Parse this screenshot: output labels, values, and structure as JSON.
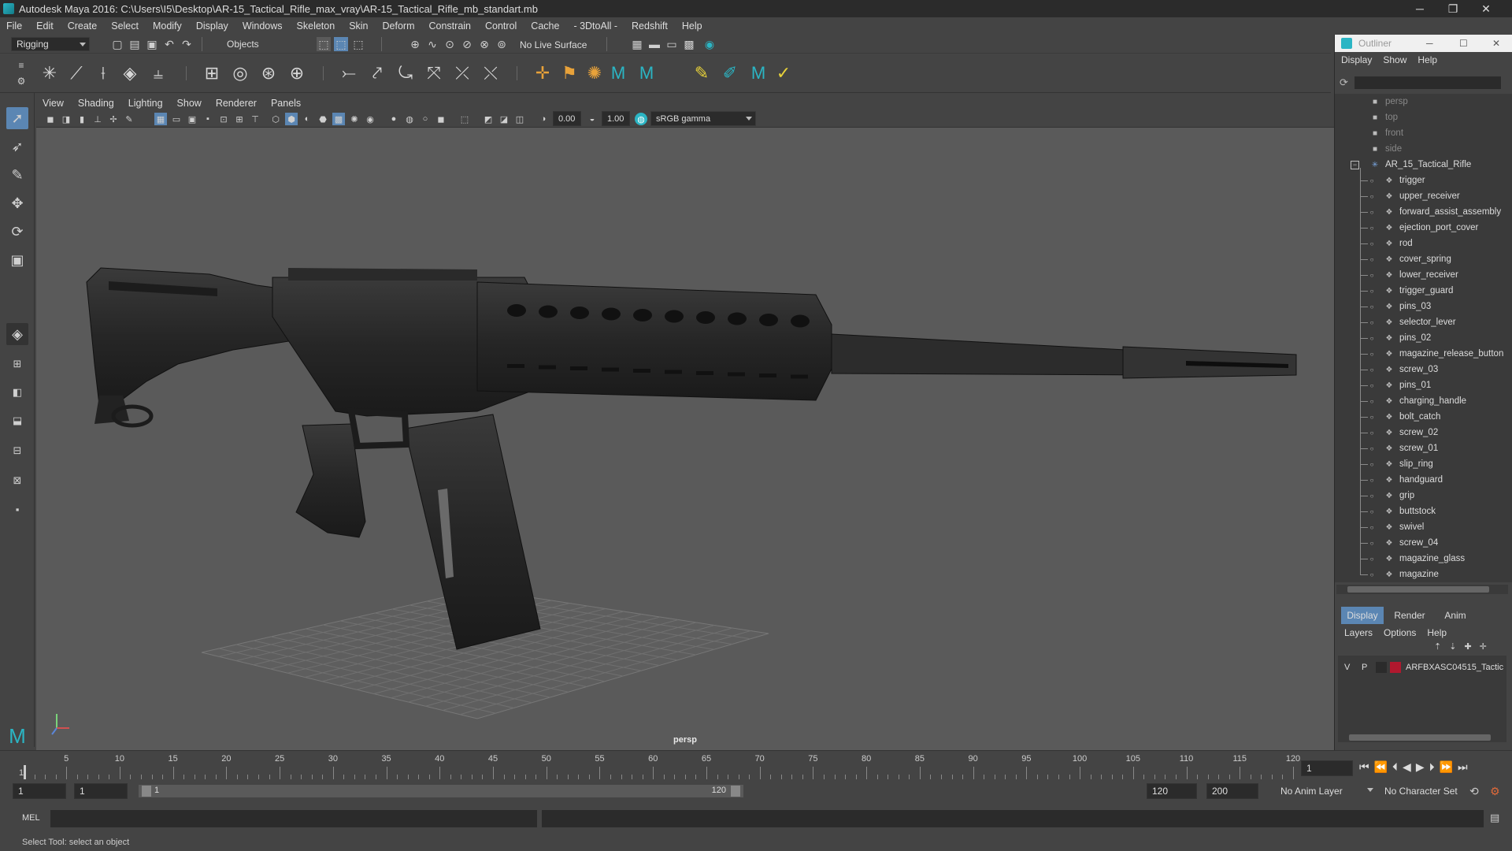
{
  "window": {
    "title": "Autodesk Maya 2016: C:\\Users\\I5\\Desktop\\AR-15_Tactical_Rifle_max_vray\\AR-15_Tactical_Rifle_mb_standart.mb",
    "minimize": "─",
    "maximize": "❐",
    "close": "✕"
  },
  "menubar": [
    "File",
    "Edit",
    "Create",
    "Select",
    "Modify",
    "Display",
    "Windows",
    "Skeleton",
    "Skin",
    "Deform",
    "Constrain",
    "Control",
    "Cache",
    "- 3DtoAll -",
    "Redshift",
    "Help"
  ],
  "statusline": {
    "mode": "Rigging",
    "selection_mode": "Objects",
    "live_surface": "No Live Surface"
  },
  "panel": {
    "menus": [
      "View",
      "Shading",
      "Lighting",
      "Show",
      "Renderer",
      "Panels"
    ],
    "exposure": "0.00",
    "gamma": "1.00",
    "color_space": "sRGB gamma",
    "camera": "persp"
  },
  "outliner": {
    "title": "Outliner",
    "menus": [
      "Display",
      "Show",
      "Help"
    ],
    "cameras": [
      "persp",
      "top",
      "front",
      "side"
    ],
    "root": "AR_15_Tactical_Rifle",
    "children": [
      "trigger",
      "upper_receiver",
      "forward_assist_assembly",
      "ejection_port_cover",
      "rod",
      "cover_spring",
      "lower_receiver",
      "trigger_guard",
      "pins_03",
      "selector_lever",
      "pins_02",
      "magazine_release_button",
      "screw_03",
      "pins_01",
      "charging_handle",
      "bolt_catch",
      "screw_02",
      "screw_01",
      "slip_ring",
      "handguard",
      "grip",
      "buttstock",
      "swivel",
      "screw_04",
      "magazine_glass",
      "magazine"
    ]
  },
  "layers": {
    "tabs": [
      "Display",
      "Render",
      "Anim"
    ],
    "menus": [
      "Layers",
      "Options",
      "Help"
    ],
    "layer_v": "V",
    "layer_p": "P",
    "layer_name": "ARFBXASC04515_Tactic",
    "layer_color": "#b0182e"
  },
  "timeline": {
    "ticks": [
      5,
      10,
      15,
      20,
      25,
      30,
      35,
      40,
      45,
      50,
      55,
      60,
      65,
      70,
      75,
      80,
      85,
      90,
      95,
      100,
      105,
      110,
      115,
      120
    ],
    "start_label": "1",
    "current_frame": "1"
  },
  "range": {
    "start": "1",
    "playback_start": "1",
    "slider_start": "1",
    "slider_end": "120",
    "playback_end": "120",
    "end": "200",
    "anim_layer": "No Anim Layer",
    "character_set": "No Character Set"
  },
  "command": {
    "mel": "MEL"
  },
  "help_line": "Select Tool: select an object",
  "colors": {
    "accent": "#2bb5c4",
    "selected": "#5b86b3"
  }
}
